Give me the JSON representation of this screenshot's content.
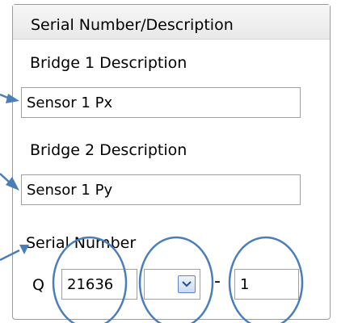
{
  "panel": {
    "header": "Serial Number/Description",
    "bridge1": {
      "label": "Bridge 1 Description",
      "value": "Sensor 1 Px"
    },
    "bridge2": {
      "label": "Bridge 2 Description",
      "value": "Sensor 1 Py"
    },
    "serial": {
      "label": "Serial Number",
      "prefix": "Q",
      "number": "21636",
      "combo_value": "",
      "separator": "-",
      "suffix": "1"
    }
  },
  "annotation_color": "#4a7ebb",
  "icons": [
    "chevron-down-icon"
  ]
}
